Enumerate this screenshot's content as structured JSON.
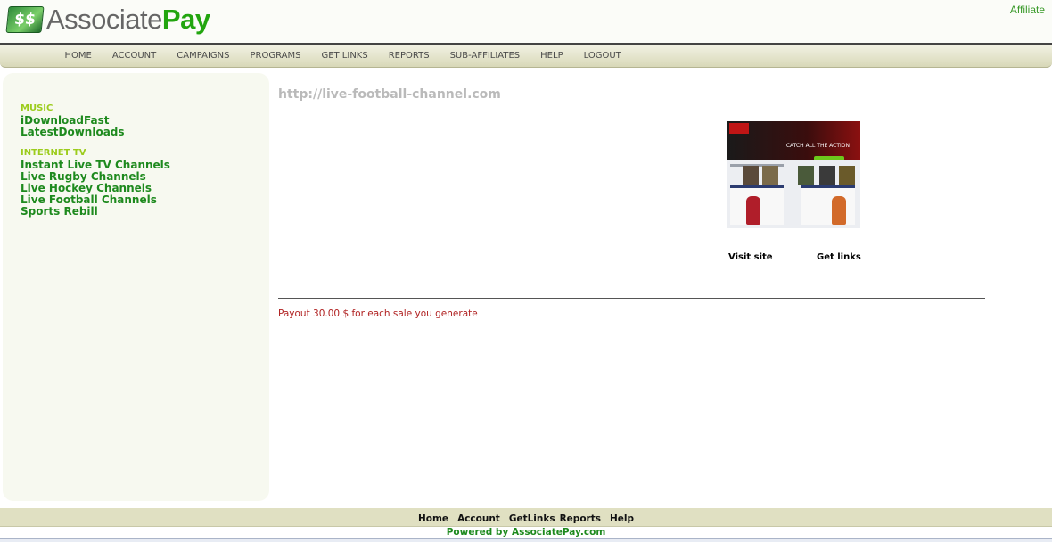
{
  "header": {
    "logo_associate": "Associate",
    "logo_pay": "Pay",
    "logo_mark": "$$",
    "affiliate_link": "Affiliate"
  },
  "nav": {
    "items": [
      "HOME",
      "ACCOUNT",
      "CAMPAIGNS",
      "PROGRAMS",
      "GET LINKS",
      "REPORTS",
      "SUB-AFFILIATES",
      "HELP",
      "LOGOUT"
    ]
  },
  "sidebar": {
    "groups": [
      {
        "category": "MUSIC",
        "links": [
          "iDownloadFast",
          "LatestDownloads"
        ]
      },
      {
        "category": "INTERNET TV",
        "links": [
          "Instant Live TV Channels",
          "Live Rugby Channels",
          "Live Hockey Channels",
          "Live Football Channels",
          "Sports Rebill"
        ]
      }
    ]
  },
  "main": {
    "url": "http://live-football-channel.com",
    "thumb_text": "CATCH ALL THE ACTION",
    "visit_site": "Visit site",
    "get_links": "Get links",
    "payout": "Payout 30.00 $ for each sale you generate"
  },
  "footer": {
    "links": [
      "Home",
      "Account",
      "GetLinks",
      "Reports",
      "Help"
    ],
    "powered": "Powered by AssociatePay.com"
  },
  "colors": {
    "brand_green": "#22a50f",
    "category_lime": "#9ccc1c",
    "link_green": "#1e8a1e",
    "payout_red": "#b02020",
    "nav_bg": "#d8d8b8"
  }
}
